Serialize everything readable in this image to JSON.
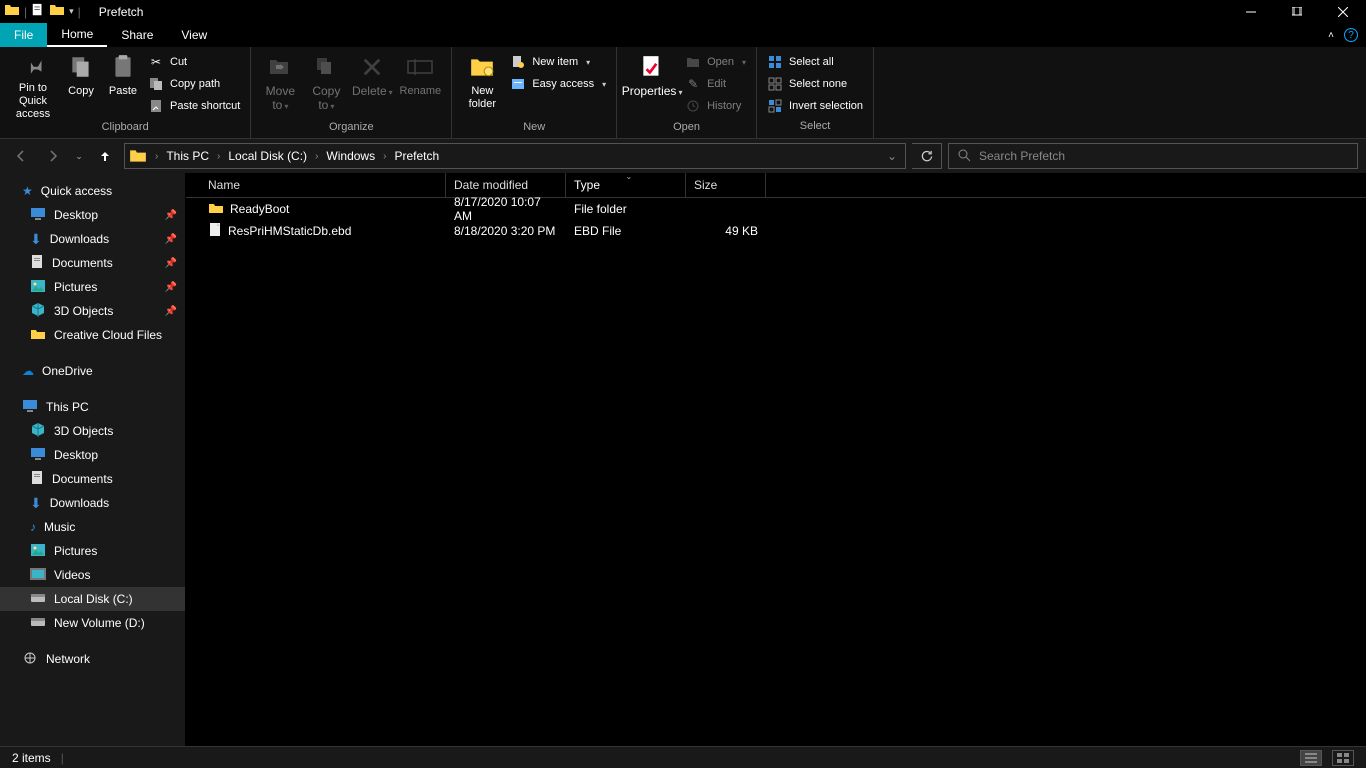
{
  "window": {
    "title": "Prefetch"
  },
  "tabs": {
    "file": "File",
    "home": "Home",
    "share": "Share",
    "view": "View"
  },
  "ribbon": {
    "clipboard": {
      "label": "Clipboard",
      "pin": "Pin to Quick access",
      "copy": "Copy",
      "paste": "Paste",
      "cut": "Cut",
      "copypath": "Copy path",
      "pasteshortcut": "Paste shortcut"
    },
    "organize": {
      "label": "Organize",
      "moveto": "Move to",
      "copyto": "Copy to",
      "delete": "Delete",
      "rename": "Rename"
    },
    "new": {
      "label": "New",
      "newfolder": "New folder",
      "newitem": "New item",
      "easyaccess": "Easy access"
    },
    "open": {
      "label": "Open",
      "properties": "Properties",
      "open": "Open",
      "edit": "Edit",
      "history": "History"
    },
    "select": {
      "label": "Select",
      "selectall": "Select all",
      "selectnone": "Select none",
      "invert": "Invert selection"
    }
  },
  "breadcrumb": [
    "This PC",
    "Local Disk (C:)",
    "Windows",
    "Prefetch"
  ],
  "search": {
    "placeholder": "Search Prefetch"
  },
  "navpane": {
    "quickaccess": "Quick access",
    "qa_items": [
      {
        "label": "Desktop",
        "pinned": true
      },
      {
        "label": "Downloads",
        "pinned": true
      },
      {
        "label": "Documents",
        "pinned": true
      },
      {
        "label": "Pictures",
        "pinned": true
      },
      {
        "label": "3D Objects",
        "pinned": true
      },
      {
        "label": "Creative Cloud Files",
        "pinned": false
      }
    ],
    "onedrive": "OneDrive",
    "thispc": "This PC",
    "pc_items": [
      "3D Objects",
      "Desktop",
      "Documents",
      "Downloads",
      "Music",
      "Pictures",
      "Videos",
      "Local Disk (C:)",
      "New Volume (D:)"
    ],
    "network": "Network"
  },
  "columns": {
    "name": "Name",
    "date": "Date modified",
    "type": "Type",
    "size": "Size"
  },
  "files": [
    {
      "name": "ReadyBoot",
      "date": "8/17/2020 10:07 AM",
      "type": "File folder",
      "size": "",
      "icon": "folder"
    },
    {
      "name": "ResPriHMStaticDb.ebd",
      "date": "8/18/2020 3:20 PM",
      "type": "EBD File",
      "size": "49 KB",
      "icon": "file"
    }
  ],
  "status": {
    "items": "2 items"
  }
}
